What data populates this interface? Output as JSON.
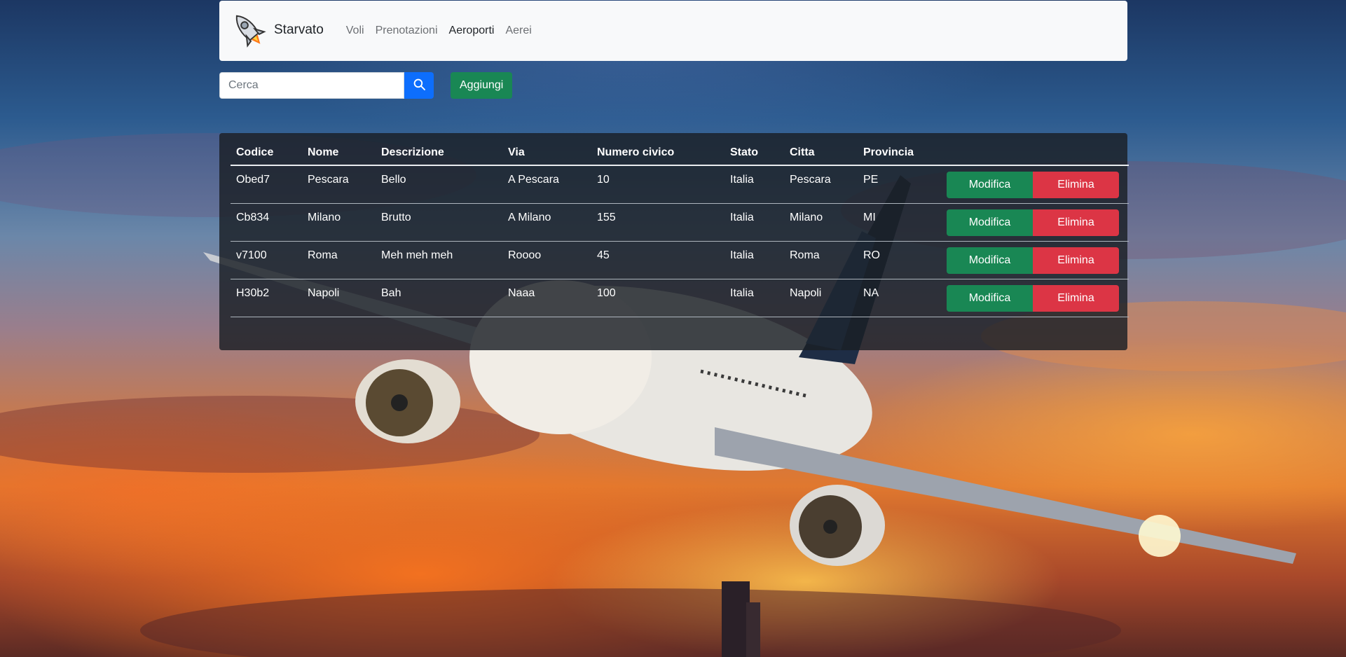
{
  "navbar": {
    "brand": "Starvato",
    "links": [
      {
        "label": "Voli",
        "active": false
      },
      {
        "label": "Prenotazioni",
        "active": false
      },
      {
        "label": "Aeroporti",
        "active": true
      },
      {
        "label": "Aerei",
        "active": false
      }
    ]
  },
  "search": {
    "placeholder": "Cerca",
    "value": "",
    "add_label": "Aggiungi"
  },
  "table": {
    "headers": [
      "Codice",
      "Nome",
      "Descrizione",
      "Via",
      "Numero civico",
      "Stato",
      "Citta",
      "Provincia"
    ],
    "rows": [
      [
        "Obed7",
        "Pescara",
        "Bello",
        "A Pescara",
        "10",
        "Italia",
        "Pescara",
        "PE"
      ],
      [
        "Cb834",
        "Milano",
        "Brutto",
        "A Milano",
        "155",
        "Italia",
        "Milano",
        "MI"
      ],
      [
        "v7100",
        "Roma",
        "Meh meh meh",
        "Roooo",
        "45",
        "Italia",
        "Roma",
        "RO"
      ],
      [
        "H30b2",
        "Napoli",
        "Bah",
        "Naaa",
        "100",
        "Italia",
        "Napoli",
        "NA"
      ]
    ],
    "edit_label": "Modifica",
    "delete_label": "Elimina"
  },
  "colors": {
    "primary": "#0d6efd",
    "success": "#198754",
    "danger": "#dc3545",
    "navbar_bg": "#f8f9fa"
  }
}
